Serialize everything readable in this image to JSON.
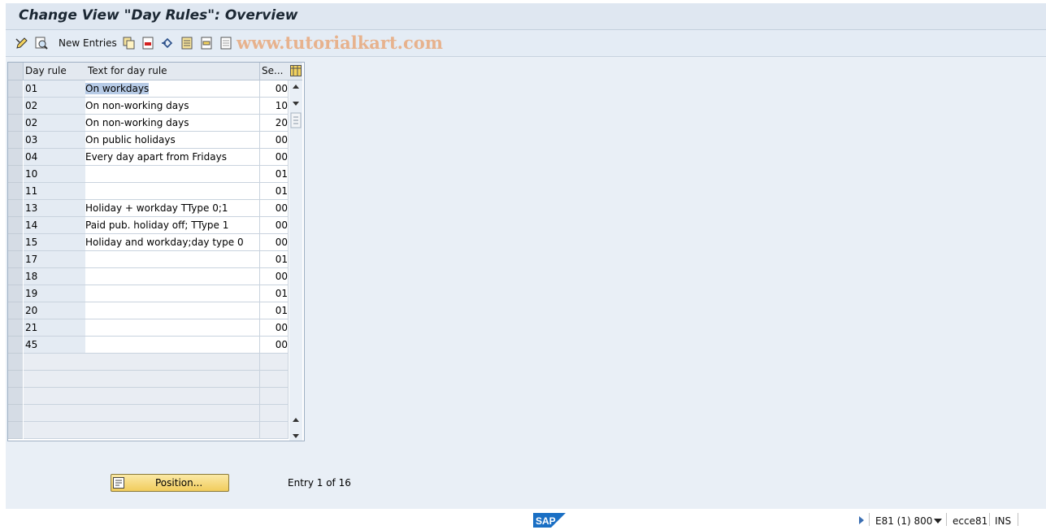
{
  "title": "Change View \"Day Rules\": Overview",
  "toolbar": {
    "new_entries": "New Entries",
    "watermark": "www.tutorialkart.com",
    "icons": [
      "display-change-icon",
      "details-icon",
      "copy-icon",
      "delete-icon",
      "undo-icon",
      "select-all-icon",
      "select-block-icon",
      "deselect-all-icon"
    ]
  },
  "table": {
    "headers": [
      "Day rule",
      "Text for day rule",
      "Se..."
    ],
    "rows": [
      {
        "key": "01",
        "text": "On workdays",
        "se": "00"
      },
      {
        "key": "02",
        "text": "On non-working days",
        "se": "10"
      },
      {
        "key": "02",
        "text": "On non-working days",
        "se": "20"
      },
      {
        "key": "03",
        "text": "On public holidays",
        "se": "00"
      },
      {
        "key": "04",
        "text": "Every day apart from Fridays",
        "se": "00"
      },
      {
        "key": "10",
        "text": "",
        "se": "01"
      },
      {
        "key": "11",
        "text": "",
        "se": "01"
      },
      {
        "key": "13",
        "text": "Holiday + workday TType 0;1",
        "se": "00"
      },
      {
        "key": "14",
        "text": "Paid pub. holiday off; TType 1",
        "se": "00"
      },
      {
        "key": "15",
        "text": "Holiday and workday;day type 0",
        "se": "00"
      },
      {
        "key": "17",
        "text": "",
        "se": "01"
      },
      {
        "key": "18",
        "text": "",
        "se": "00"
      },
      {
        "key": "19",
        "text": "",
        "se": "01"
      },
      {
        "key": "20",
        "text": "",
        "se": "01"
      },
      {
        "key": "21",
        "text": "",
        "se": "00"
      },
      {
        "key": "45",
        "text": "",
        "se": "00"
      }
    ],
    "empty_rows": 5
  },
  "position_button": "Position...",
  "entry_info": "Entry 1 of 16",
  "status": {
    "system": "E81 (1) 800",
    "server": "ecce81",
    "mode": "INS"
  },
  "colors": {
    "accent": "#f1cc5c",
    "selection": "#b7cbe6",
    "sap_blue": "#1a6fc4"
  }
}
